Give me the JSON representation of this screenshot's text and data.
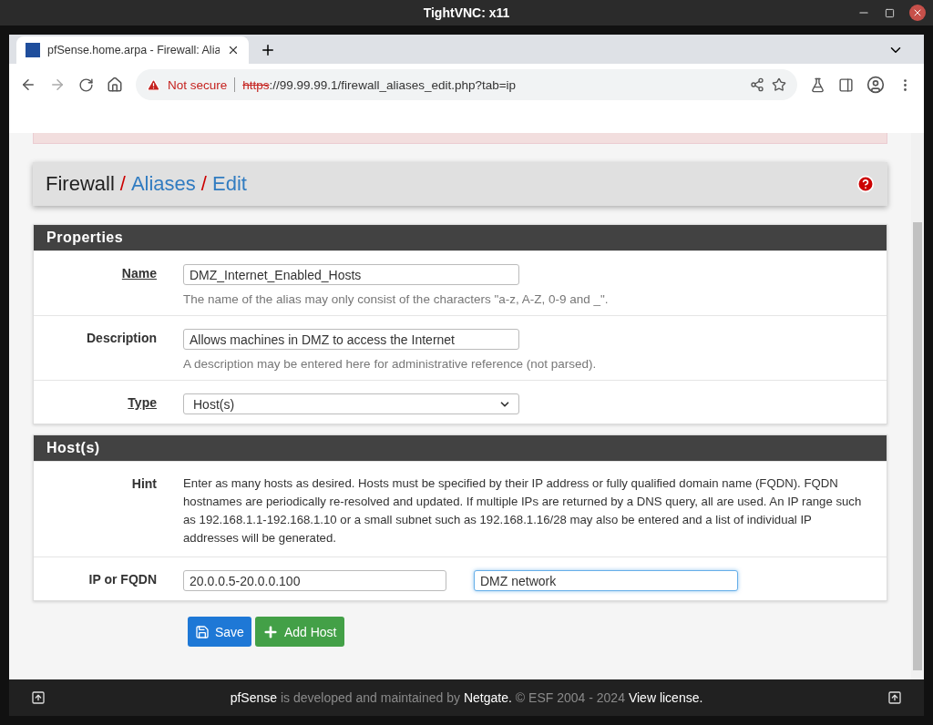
{
  "window": {
    "title": "TightVNC: x11"
  },
  "browser": {
    "tabs": [
      {
        "title": "pfSense.home.arpa - Firewall: Alia",
        "selected": true
      }
    ],
    "security": "Not secure",
    "url_scheme": "https",
    "url_rest": "://99.99.99.1/firewall_aliases_edit.php?tab=ip"
  },
  "breadcrumb": [
    {
      "label": "Firewall",
      "kind": "current",
      "separator": "/"
    },
    {
      "label": "Aliases",
      "kind": "link",
      "separator": "/"
    },
    {
      "label": "Edit",
      "kind": "link"
    }
  ],
  "panels": [
    {
      "title": "Properties",
      "rows": [
        {
          "kind": "input",
          "label": "Name",
          "underlined": true,
          "value": "DMZ_Internet_Enabled_Hosts",
          "help": "The name of the alias may only consist of the characters \"a-z, A-Z, 0-9 and _\"."
        },
        {
          "kind": "input",
          "label": "Description",
          "underlined": false,
          "value": "Allows machines in DMZ to access the Internet",
          "help": "A description may be entered here for administrative reference (not parsed)."
        },
        {
          "kind": "select",
          "label": "Type",
          "underlined": true,
          "value": "Host(s)"
        }
      ]
    },
    {
      "title": "Host(s)",
      "rows": [
        {
          "kind": "text",
          "label": "Hint",
          "underlined": false,
          "text": "Enter as many hosts as desired. Hosts must be specified by their IP address or fully qualified domain name (FQDN). FQDN hostnames are periodically re-resolved and updated. If multiple IPs are returned by a DNS query, all are used. An IP range such as 192.168.1.1-192.168.1.10 or a small subnet such as 192.168.1.16/28 may also be entered and a list of individual IP addresses will be generated."
        },
        {
          "kind": "pair",
          "label": "IP or FQDN",
          "underlined": false,
          "value": "20.0.0.5-20.0.0.100",
          "second_value": "DMZ network",
          "second_focused": true
        }
      ]
    }
  ],
  "buttons": [
    {
      "label": "Save",
      "kind": "save"
    },
    {
      "label": "Add Host",
      "kind": "add"
    }
  ],
  "footer": [
    {
      "text": "pfSense",
      "kind": "link"
    },
    {
      "text": "is developed and maintained by",
      "kind": "text"
    },
    {
      "text": "Netgate.",
      "kind": "link"
    },
    {
      "text": "© ESF 2004 - 2024",
      "kind": "text"
    },
    {
      "text": "View license.",
      "kind": "link"
    }
  ]
}
